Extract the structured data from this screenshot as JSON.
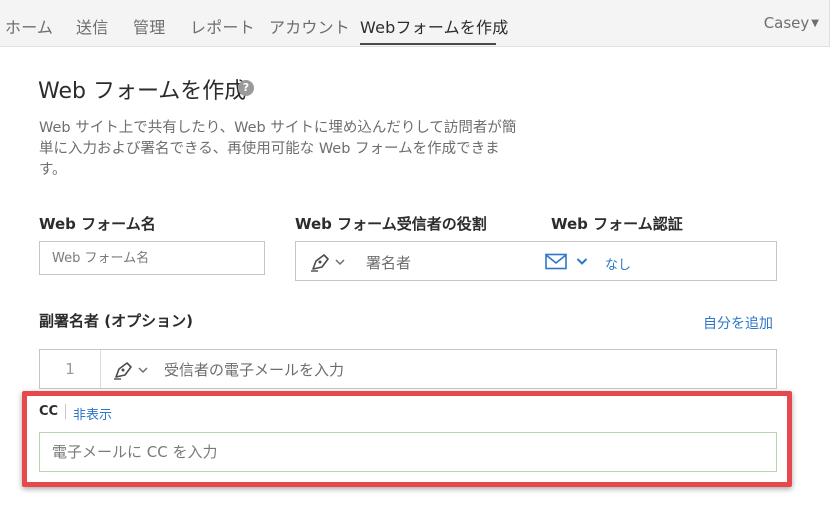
{
  "nav": {
    "items": [
      {
        "label": "ホーム"
      },
      {
        "label": "送信"
      },
      {
        "label": "管理"
      },
      {
        "label": "レポート"
      },
      {
        "label": "アカウント"
      },
      {
        "label": "Webフォームを作成"
      }
    ],
    "user": "Casey"
  },
  "page": {
    "title": "Web フォームを作成",
    "description": "Web サイト上で共有したり、Web サイトに埋め込んだりして訪問者が簡単に入力および署名できる、再使用可能な Web フォームを作成できます。"
  },
  "form": {
    "name_label": "Web フォーム名",
    "name_placeholder": "Web フォーム名",
    "role_label": "Web フォーム受信者の役割",
    "role_value": "署名者",
    "auth_label": "Web フォーム認証",
    "auth_value": "なし",
    "cosigner_label": "副署名者 (オプション)",
    "add_self": "自分を追加",
    "recipient_number": "1",
    "recipient_placeholder": "受信者の電子メールを入力",
    "cc_label": "CC",
    "cc_hide": "非表示",
    "cc_placeholder": "電子メールに CC を入力"
  },
  "colors": {
    "link": "#2d77c9",
    "highlight": "#e5484d"
  }
}
